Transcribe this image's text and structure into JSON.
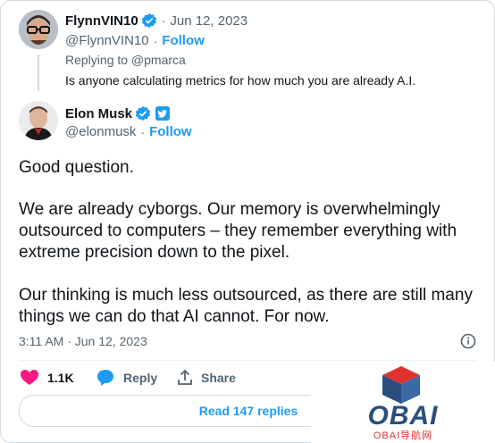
{
  "reply_tweet": {
    "name": "FlynnVIN10",
    "date": "Jun 12, 2023",
    "handle": "@FlynnVIN10",
    "follow": "Follow",
    "replying_to": "Replying to @pmarca",
    "text": "Is anyone calculating metrics for how much you are already A.I."
  },
  "main_tweet": {
    "name": "Elon Musk",
    "handle": "@elonmusk",
    "follow": "Follow",
    "paragraphs": [
      "Good question.",
      "We are already cyborgs. Our memory is overwhelmingly outsourced to computers – they remember everything with extreme precision down to the pixel.",
      "Our thinking is much less outsourced, as there are still many things we can do that AI cannot. For now."
    ],
    "timestamp": "3:11 AM · Jun 12, 2023"
  },
  "actions": {
    "likes": "1.1K",
    "reply": "Reply",
    "share": "Share"
  },
  "read_replies": "Read 147 replies",
  "watermark": {
    "logo_text": "OBAI",
    "sub_text": "OBAI导航网"
  },
  "colors": {
    "accent": "#1d9bf0",
    "like": "#f91880",
    "muted": "#536471",
    "logo_blue": "#2b4e7d",
    "logo_red": "#e03131"
  }
}
